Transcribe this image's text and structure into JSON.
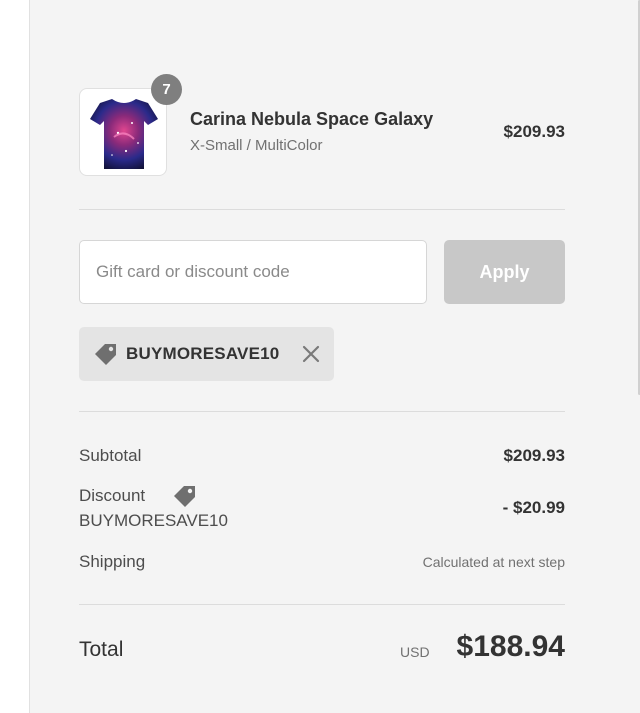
{
  "product": {
    "name": "Carina Nebula Space Galaxy",
    "variant": "X-Small / MultiColor",
    "price": "$209.93",
    "quantity": "7",
    "image_icon": "tshirt-image"
  },
  "discount": {
    "placeholder": "Gift card or discount code",
    "value": "",
    "apply_label": "Apply",
    "applied_code": "BUYMORESAVE10",
    "tag_icon": "tag-icon",
    "remove_icon": "close-icon"
  },
  "summary": {
    "subtotal_label": "Subtotal",
    "subtotal_value": "$209.93",
    "discount_label": "Discount",
    "discount_code": "BUYMORESAVE10",
    "discount_value": "- $20.99",
    "shipping_label": "Shipping",
    "shipping_value": "Calculated at next step"
  },
  "total": {
    "label": "Total",
    "currency": "USD",
    "amount": "$188.94"
  },
  "colors": {
    "sidebar_bg": "#f4f4f4",
    "apply_disabled": "#c8c8c8",
    "chip_bg": "#e4e4e4",
    "badge_bg": "#7f7f7f"
  }
}
